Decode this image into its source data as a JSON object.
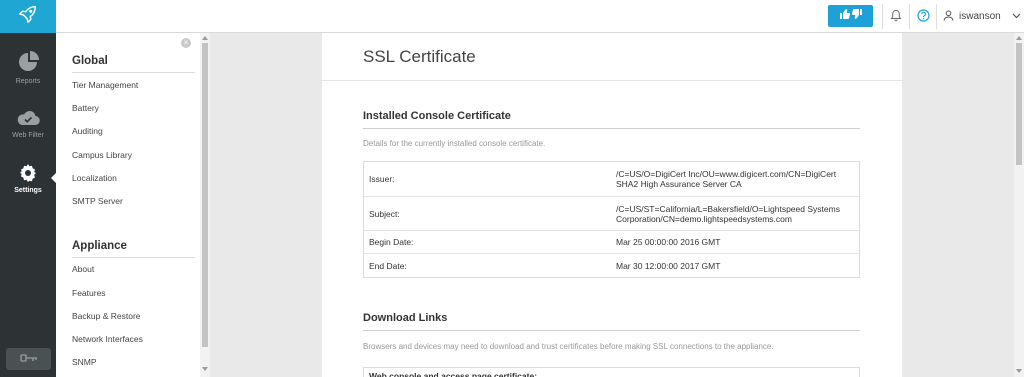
{
  "colors": {
    "brand": "#1fa6d3",
    "rail": "#2d3335",
    "feedback": "#1da1d6"
  },
  "header": {
    "logo_icon": "rocket-icon",
    "feedback_icon": "thumbs-up-down-icon",
    "notifications_icon": "bell-icon",
    "help_icon": "question-icon",
    "user_icon": "user-icon",
    "username": "iswanson"
  },
  "rail": {
    "items": [
      {
        "label": "Reports",
        "icon": "pie-chart-icon"
      },
      {
        "label": "Web Filter",
        "icon": "cloud-icon"
      },
      {
        "label": "Settings",
        "icon": "gear-icon"
      }
    ],
    "bottom_icon": "key-icon"
  },
  "sidebar": {
    "groups": [
      {
        "title": "Global",
        "items": [
          "Tier Management",
          "Battery",
          "Auditing",
          "Campus Library",
          "Localization",
          "SMTP Server"
        ]
      },
      {
        "title": "Appliance",
        "items": [
          "About",
          "Features",
          "Backup & Restore",
          "Network Interfaces",
          "SNMP"
        ]
      }
    ],
    "close_icon": "close-icon"
  },
  "main": {
    "title": "SSL Certificate",
    "installed": {
      "title": "Installed Console Certificate",
      "description": "Details for the currently installed console certificate.",
      "rows": [
        {
          "label": "Issuer:",
          "value": "/C=US/O=DigiCert Inc/OU=www.digicert.com/CN=DigiCert SHA2 High Assurance Server CA"
        },
        {
          "label": "Subject:",
          "value": "/C=US/ST=California/L=Bakersfield/O=Lightspeed Systems Corporation/CN=demo.lightspeedsystems.com"
        },
        {
          "label": "Begin Date:",
          "value": "Mar 25 00:00:00 2016 GMT"
        },
        {
          "label": "End Date:",
          "value": "Mar 30 12:00:00 2017 GMT"
        }
      ]
    },
    "download": {
      "title": "Download Links",
      "description": "Browsers and devices may need to download and trust certificates before making SSL connections to the appliance.",
      "box_heading": "Web console and access page certificate:"
    }
  }
}
